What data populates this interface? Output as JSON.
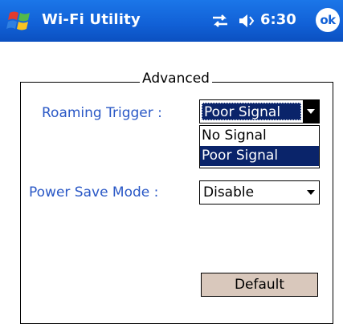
{
  "titlebar": {
    "app_title": "Wi-Fi Utility",
    "clock": "6:30",
    "ok_label": "ok",
    "icons": [
      "windows-start-icon",
      "connectivity-icon",
      "volume-icon"
    ],
    "background_color": "#1160d6"
  },
  "group": {
    "title": "Advanced"
  },
  "roaming": {
    "label": "Roaming Trigger :",
    "selected_value": "Poor Signal",
    "options": [
      "No Signal",
      "Poor Signal"
    ],
    "highlighted_option": "Poor Signal"
  },
  "power_save": {
    "label": "Power Save Mode :",
    "selected_value": "Disable"
  },
  "buttons": {
    "default_label": "Default"
  },
  "colors": {
    "label_text": "#2a58c6",
    "selection": "#0a246a",
    "button_face": "#d9c8bc"
  }
}
